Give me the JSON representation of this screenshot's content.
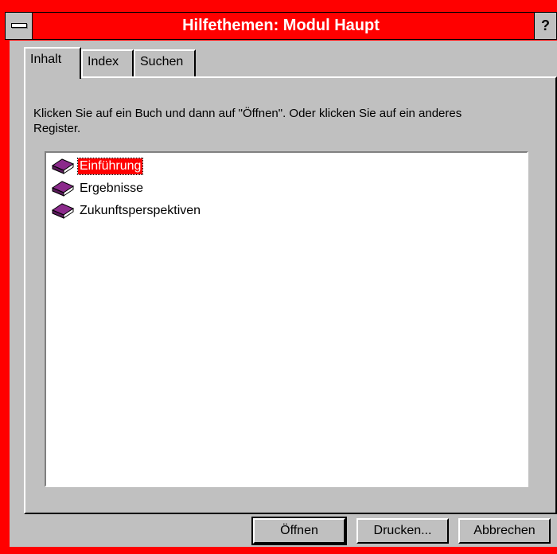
{
  "window": {
    "title": "Hilfethemen: Modul Haupt",
    "help_label": "?"
  },
  "tabs": [
    {
      "label": "Inhalt",
      "active": true
    },
    {
      "label": "Index",
      "active": false
    },
    {
      "label": "Suchen",
      "active": false
    }
  ],
  "instructions": "Klicken Sie auf ein Buch und dann auf \"Öffnen\". Oder klicken Sie auf ein anderes Register.",
  "topics": [
    {
      "label": "Einführung",
      "icon": "book-icon",
      "selected": true
    },
    {
      "label": "Ergebnisse",
      "icon": "book-icon",
      "selected": false
    },
    {
      "label": "Zukunftsperspektiven",
      "icon": "book-icon",
      "selected": false
    }
  ],
  "buttons": {
    "open": "Öffnen",
    "print": "Drucken...",
    "cancel": "Abbrechen"
  },
  "colors": {
    "accent": "#ff0000",
    "face": "#c0c0c0",
    "book": "#8b2a8b"
  }
}
